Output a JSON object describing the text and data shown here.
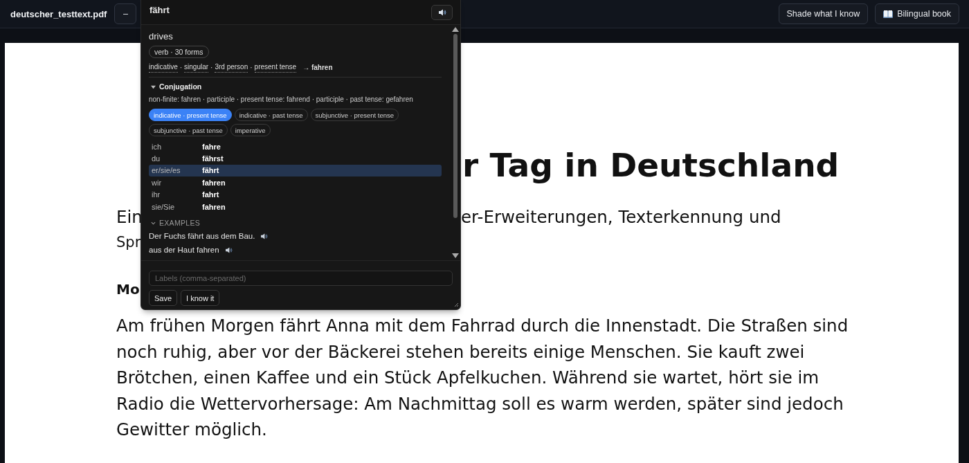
{
  "toolbar": {
    "file_name": "deutscher_testtext.pdf",
    "zoom_out": "–",
    "buttons": [
      {
        "label": "Shade what I know",
        "kind": "plain"
      },
      {
        "label": "Bilingual book",
        "kind": "book"
      }
    ]
  },
  "document": {
    "title_visible": "r Tag in Deutschland",
    "intro_fragments": [
      "Ein",
      "er-Erweiterungen, Texterkennung und",
      "Spr"
    ],
    "heading_visible": "Mo",
    "paragraph": "Am frühen Morgen fährt Anna mit dem Fahrrad durch die Innenstadt. Die Straßen sind noch ruhig, aber vor der Bäckerei stehen bereits einige Menschen. Sie kauft zwei Brötchen, einen Kaffee und ein Stück Apfelkuchen. Während sie wartet, hört sie im Radio die Wettervorhersage: Am Nachmittag soll es warm werden, später sind jedoch Gewitter möglich."
  },
  "popup": {
    "word": "fährt",
    "translation": "drives",
    "pos_chip": "verb · 30 forms",
    "grammar_tags": [
      "indicative",
      "singular",
      "3rd person",
      "present tense"
    ],
    "tag_separator": "·",
    "lemma": "→ **fahren**",
    "conjugation": {
      "title": "Conjugation",
      "expanded": true,
      "non_finite": "non-finite: fahren · participle · present tense: fahrend · participle · past tense: gefahren",
      "moods": [
        {
          "label": "indicative · present tense",
          "selected": true
        },
        {
          "label": "indicative · past tense",
          "selected": false
        },
        {
          "label": "subjunctive · present tense",
          "selected": false
        },
        {
          "label": "subjunctive · past tense",
          "selected": false
        },
        {
          "label": "imperative",
          "selected": false
        }
      ],
      "rows": [
        {
          "person": "ich",
          "form": "fahre",
          "selected": false
        },
        {
          "person": "du",
          "form": "fährst",
          "selected": false
        },
        {
          "person": "er/sie/es",
          "form": "fährt",
          "selected": true
        },
        {
          "person": "wir",
          "form": "fahren",
          "selected": false
        },
        {
          "person": "ihr",
          "form": "fahrt",
          "selected": false
        },
        {
          "person": "sie/Sie",
          "form": "fahren",
          "selected": false
        }
      ]
    },
    "examples": {
      "title": "EXAMPLES",
      "expanded": true,
      "items": [
        "Der Fuchs fährt aus dem Bau.",
        "aus der Haut fahren"
      ]
    },
    "labels_placeholder": "Labels (comma-separated)",
    "actions": [
      "Save",
      "I know it"
    ]
  }
}
